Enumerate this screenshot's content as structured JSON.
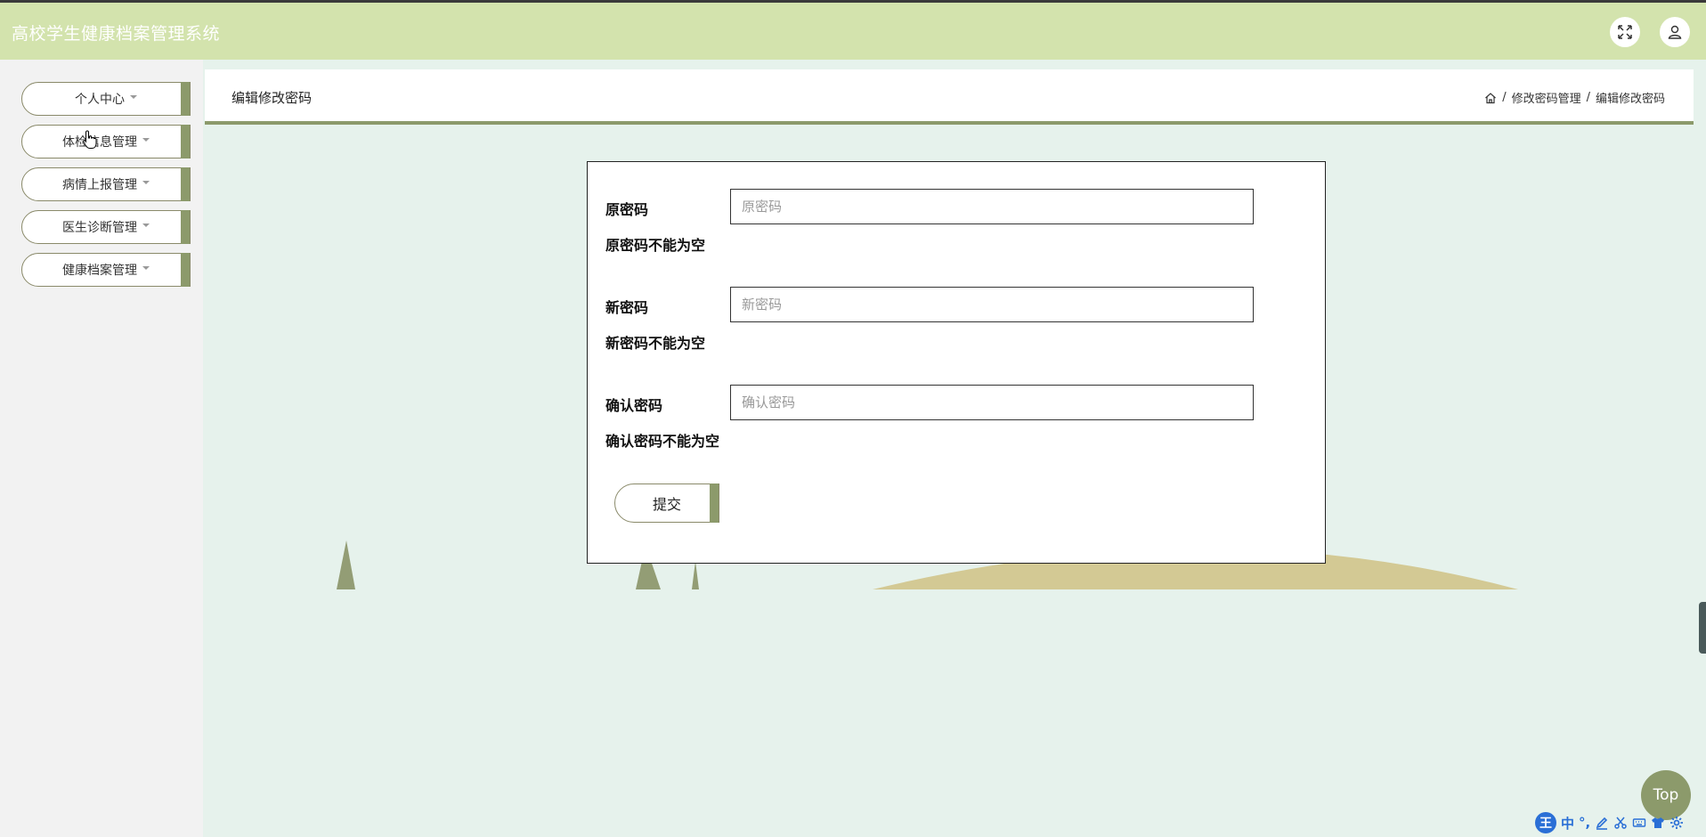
{
  "app": {
    "title": "高校学生健康档案管理系统"
  },
  "header": {
    "fullscreen_icon": "fullscreen-icon",
    "user_icon": "user-icon"
  },
  "sidebar": {
    "items": [
      {
        "label": "个人中心"
      },
      {
        "label": "体检信息管理"
      },
      {
        "label": "病情上报管理"
      },
      {
        "label": "医生诊断管理"
      },
      {
        "label": "健康档案管理"
      }
    ]
  },
  "page": {
    "title": "编辑修改密码",
    "breadcrumb": {
      "home_icon": "home-icon",
      "separator": "/",
      "level1": "修改密码管理",
      "level2": "编辑修改密码"
    }
  },
  "form": {
    "old_password": {
      "label": "原密码",
      "placeholder": "原密码",
      "error": "原密码不能为空"
    },
    "new_password": {
      "label": "新密码",
      "placeholder": "新密码",
      "error": "新密码不能为空"
    },
    "confirm_password": {
      "label": "确认密码",
      "placeholder": "确认密码",
      "error": "确认密码不能为空"
    },
    "submit_label": "提交"
  },
  "top_button": {
    "label": "Top"
  },
  "ime": {
    "logo": "王",
    "mode": "中",
    "punct": "°,"
  },
  "colors": {
    "header_bg": "#d3e3ad",
    "accent": "#8c9a6b",
    "page_bg": "#e6f2ec",
    "hill": "#d3c994",
    "ime_blue": "#2a6fd6"
  }
}
